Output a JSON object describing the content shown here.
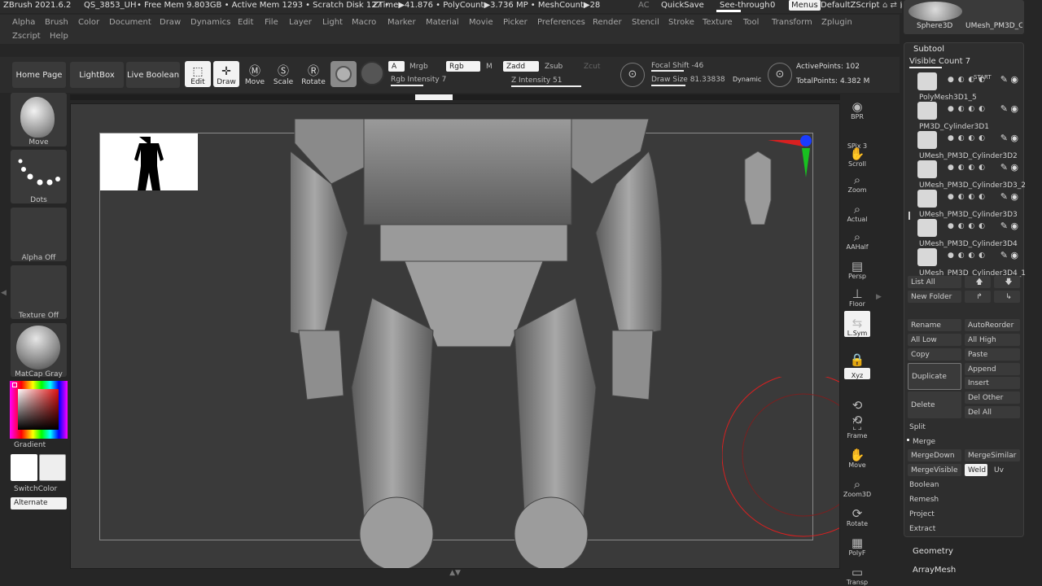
{
  "titlebar": {
    "app": "ZBrush 2021.6.2",
    "doc": "QS_3853_UH",
    "stats": "• Free Mem 9.803GB • Active Mem 1293 • Scratch Disk 127 •",
    "ztime": "ZTime▶41.876 • PolyCount▶3.736 MP • MeshCount▶28",
    "ac": "AC",
    "quicksave": "QuickSave",
    "seethrough": "See-through",
    "seethrough_val": "0",
    "menus": "Menus",
    "script": "DefaultZScript"
  },
  "menus": [
    "Alpha",
    "Brush",
    "Color",
    "Document",
    "Draw",
    "Dynamics",
    "Edit",
    "File",
    "Layer",
    "Light",
    "Macro",
    "Marker",
    "Material",
    "Movie",
    "Picker",
    "Preferences",
    "Render",
    "Stencil",
    "Stroke",
    "Texture",
    "Tool",
    "Transform",
    "Zplugin"
  ],
  "menus2": [
    "Zscript",
    "Help"
  ],
  "shelf": {
    "home": "Home Page",
    "lightbox": "LightBox",
    "liveboolean": "Live Boolean",
    "tools": [
      "Edit",
      "Draw",
      "Move",
      "Scale",
      "Rotate"
    ],
    "a": "A",
    "mrgb": "Mrgb",
    "rgb": "Rgb",
    "m": "M",
    "rgb_intensity": "Rgb Intensity 7",
    "zadd": "Zadd",
    "zsub": "Zsub",
    "zcut": "Zcut",
    "z_intensity": "Z Intensity 51",
    "focal_shift": "Focal Shift -46",
    "draw_size": "Draw Size 81.33838",
    "dynamic": "Dynamic",
    "active_points": "ActivePoints: 102",
    "total_points": "TotalPoints: 4.382 M"
  },
  "leftpanel": {
    "brush": "Move",
    "stroke": "Dots",
    "alpha": "Alpha Off",
    "texture": "Texture Off",
    "material": "MatCap Gray",
    "gradient": "Gradient",
    "switchcolor": "SwitchColor",
    "alternate": "Alternate"
  },
  "rightrail": [
    "BPR",
    "SPix 3",
    "Scroll",
    "Zoom",
    "Actual",
    "AAHalf",
    "Persp",
    "Floor",
    "L.Sym",
    "",
    "Xyz",
    "",
    "",
    "Frame",
    "Move",
    "Zoom3D",
    "Rotate",
    "PolyF",
    "Transp"
  ],
  "sidebar": {
    "top_thumbs": [
      "Sphere3D",
      "UMesh_PM3D_C"
    ],
    "subtool": "Subtool",
    "visible_count": "Visible Count 7",
    "start": "START",
    "items": [
      "PolyMesh3D1_5",
      "PM3D_Cylinder3D1",
      "UMesh_PM3D_Cylinder3D2",
      "UMesh_PM3D_Cylinder3D3_2",
      "UMesh_PM3D_Cylinder3D3",
      "UMesh_PM3D_Cylinder3D4",
      "UMesh_PM3D_Cylinder3D4_1"
    ],
    "listall": "List All",
    "newfolder": "New Folder",
    "rename": "Rename",
    "autoreorder": "AutoReorder",
    "alllow": "All Low",
    "allhigh": "All High",
    "copy": "Copy",
    "paste": "Paste",
    "duplicate": "Duplicate",
    "append": "Append",
    "insert": "Insert",
    "delete": "Delete",
    "delother": "Del Other",
    "delall": "Del All",
    "split": "Split",
    "merge": "Merge",
    "mergedown": "MergeDown",
    "mergesimilar": "MergeSimilar",
    "mergevisible": "MergeVisible",
    "weld": "Weld",
    "uv": "Uv",
    "boolean": "Boolean",
    "remesh": "Remesh",
    "project": "Project",
    "extract": "Extract",
    "geometry": "Geometry",
    "arraymesh": "ArrayMesh"
  },
  "colors": {
    "accent_red": "#d82020",
    "gizmo_blue": "#1a3cff",
    "gizmo_green": "#18c020"
  }
}
